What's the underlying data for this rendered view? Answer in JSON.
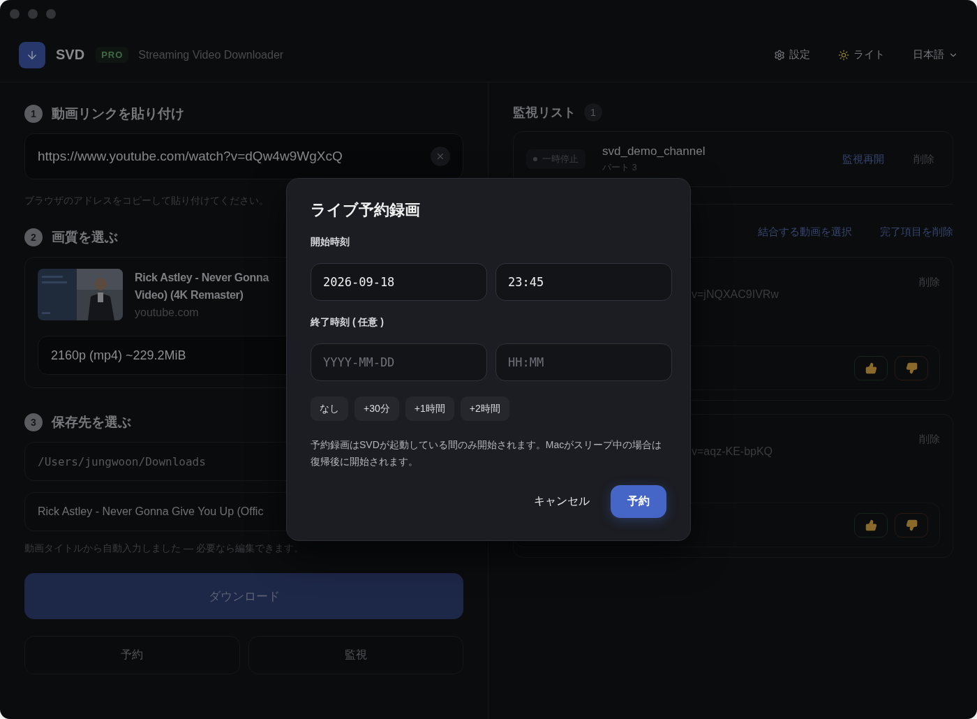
{
  "header": {
    "app_name": "SVD",
    "badge": "PRO",
    "subtitle": "Streaming Video Downloader",
    "actions": [
      {
        "kind": "settings",
        "label": "設定"
      },
      {
        "kind": "theme",
        "label": "ライト"
      },
      {
        "kind": "language",
        "label": "日本語"
      }
    ]
  },
  "step1": {
    "number": "1",
    "title": "動画リンクを貼り付け",
    "url": "https://www.youtube.com/watch?v=dQw4w9WgXcQ",
    "hint": "ブラウザのアドレスをコピーして貼り付けてください。"
  },
  "step2": {
    "number": "2",
    "title": "画質を選ぶ",
    "video_title_lines": [
      "Rick Astley - Never Gonna",
      "Video) (4K Remaster)"
    ],
    "source": "youtube.com",
    "format": "2160p (mp4) ~229.2MiB"
  },
  "step3": {
    "number": "3",
    "title": "保存先を選ぶ",
    "folder": "/Users/jungwoon/Downloads",
    "filename": "Rick Astley - Never Gonna Give You Up (Offic",
    "hint": "動画タイトルから自動入力しました — 必要なら編集できます。"
  },
  "actions": {
    "download": "ダウンロード",
    "schedule": "予約",
    "monitor": "監視"
  },
  "watch_list": {
    "title": "監視リスト",
    "count": "1",
    "items": [
      {
        "status": "一時停止",
        "name": "svd_demo_channel",
        "detail": "パート 3",
        "resume": "監視再開",
        "delete": "削除"
      }
    ]
  },
  "downloads": {
    "actions": [
      "結合する動画を選択",
      "完了項目を削除"
    ],
    "items": [
      {
        "url_tail": "v=jNQXAC9IVRw",
        "delete": "削除"
      },
      {
        "url_tail": "v=aqz-KE-bpKQ",
        "delete": "削除"
      }
    ]
  },
  "modal": {
    "title": "ライブ予約録画",
    "start": {
      "label": "開始時刻",
      "date": "2026-09-18",
      "time": "23:45"
    },
    "end": {
      "label": "終了時刻 ( 任意 )",
      "date_placeholder": "YYYY-MM-DD",
      "time_placeholder": "HH:MM"
    },
    "presets": [
      "なし",
      "+30分",
      "+1時間",
      "+2時間"
    ],
    "note": "予約録画はSVDが起動している間のみ開始されます。Macがスリープ中の場合は復帰後に開始されます。",
    "cancel": "キャンセル",
    "confirm": "予約"
  }
}
